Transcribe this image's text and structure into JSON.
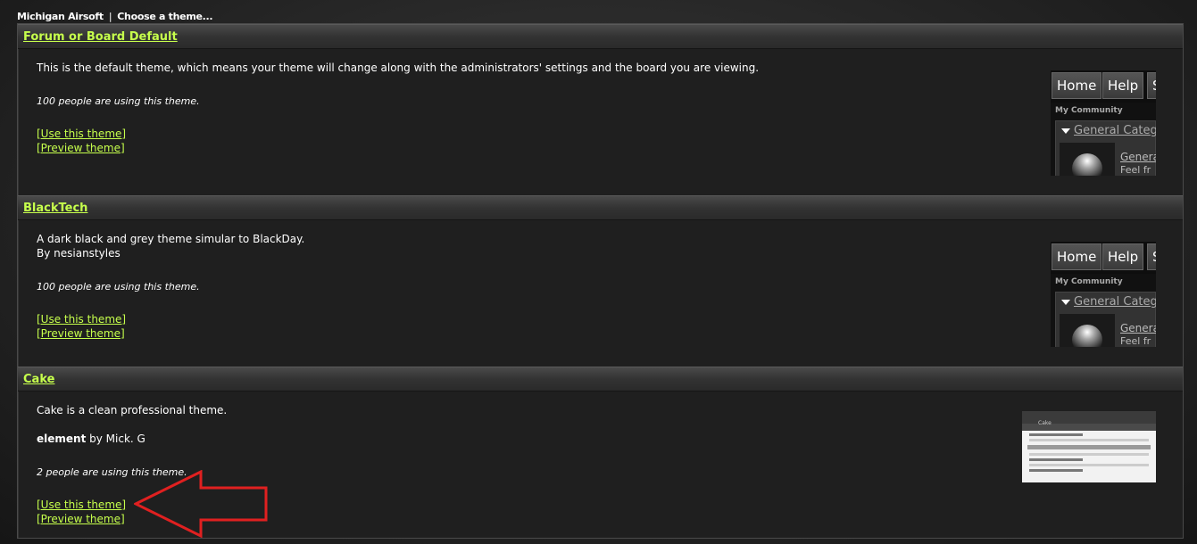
{
  "breadcrumb": {
    "site": "Michigan Airsoft",
    "separator": "|",
    "page": "Choose a theme..."
  },
  "preview": {
    "home": "Home",
    "help": "Help",
    "s": "S",
    "community": "My Community",
    "category": "General Categ",
    "forum": "Genera",
    "forum_desc": "Feel fr"
  },
  "cake_preview_logo": "Cake",
  "themes": [
    {
      "name": "Forum or Board Default",
      "description": "This is the default theme, which means your theme will change along with the administrators' settings and the board you are viewing.",
      "usage": "100 people are using this theme.",
      "use_label": "[Use this theme]",
      "preview_label": "[Preview theme]"
    },
    {
      "name": "BlackTech",
      "description": "A dark black and grey theme simular to BlackDay.",
      "author_line": "By nesianstyles",
      "usage": "100 people are using this theme.",
      "use_label": "[Use this theme]",
      "preview_label": "[Preview theme]"
    },
    {
      "name": "Cake",
      "description": "Cake is a clean professional theme.",
      "author_bold": "element",
      "author_rest": " by Mick. G",
      "usage": "2 people are using this theme.",
      "use_label": "[Use this theme]",
      "preview_label": "[Preview theme]"
    }
  ],
  "colors": {
    "link": "#c6ff4c",
    "arrow": "#e02020",
    "background": "#1f1f1f"
  }
}
